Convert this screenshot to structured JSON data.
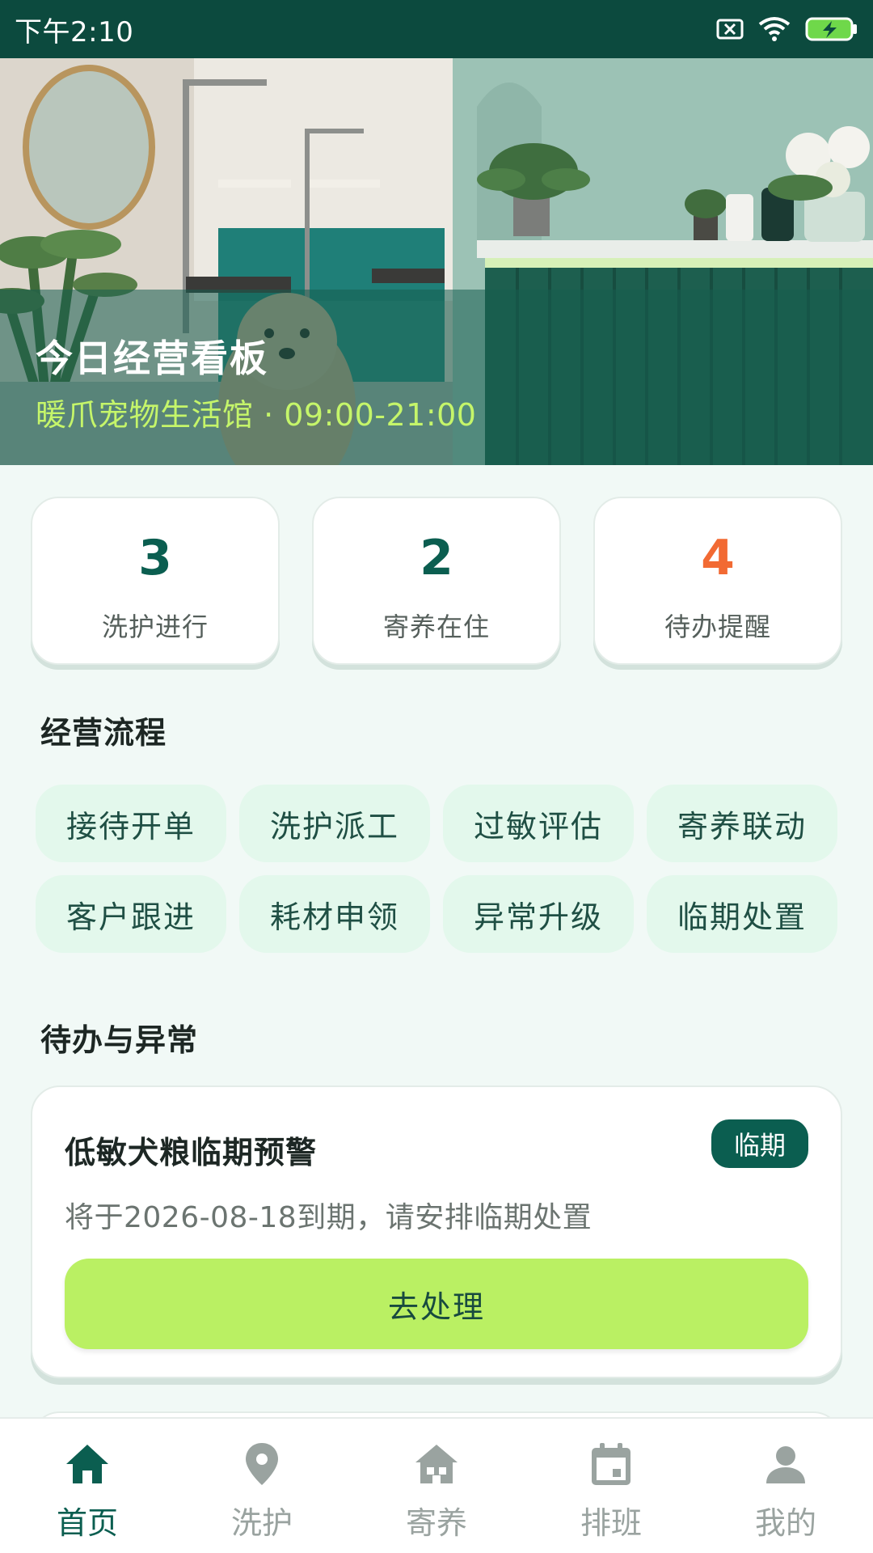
{
  "status_bar": {
    "time": "下午2:10",
    "icons": [
      "sim-off-icon",
      "wifi-icon",
      "battery-charging-icon"
    ]
  },
  "hero": {
    "title": "今日经营看板",
    "subtitle": "暖爪宠物生活馆 · 09:00-21:00"
  },
  "stats": [
    {
      "value": "3",
      "label": "洗护进行"
    },
    {
      "value": "2",
      "label": "寄养在住"
    },
    {
      "value": "4",
      "label": "待办提醒"
    }
  ],
  "process": {
    "title": "经营流程",
    "items": [
      "接待开单",
      "洗护派工",
      "过敏评估",
      "寄养联动",
      "客户跟进",
      "耗材申领",
      "异常升级",
      "临期处置"
    ]
  },
  "todo": {
    "title": "待办与异常",
    "card": {
      "title": "低敏犬粮临期预警",
      "badge": "临期",
      "description": "将于2026-08-18到期，请安排临期处置",
      "action": "去处理"
    }
  },
  "bottom_nav": {
    "items": [
      {
        "label": "首页",
        "icon": "home-icon",
        "active": true
      },
      {
        "label": "洗护",
        "icon": "location-pin-icon",
        "active": false
      },
      {
        "label": "寄养",
        "icon": "pet-house-icon",
        "active": false
      },
      {
        "label": "排班",
        "icon": "calendar-icon",
        "active": false
      },
      {
        "label": "我的",
        "icon": "person-icon",
        "active": false
      }
    ]
  },
  "colors": {
    "primary": "#0b5e50",
    "accent_lime": "#baf063",
    "warning": "#f26a33",
    "chip_bg": "#e3f8ec",
    "page_bg": "#f1f9f6"
  }
}
